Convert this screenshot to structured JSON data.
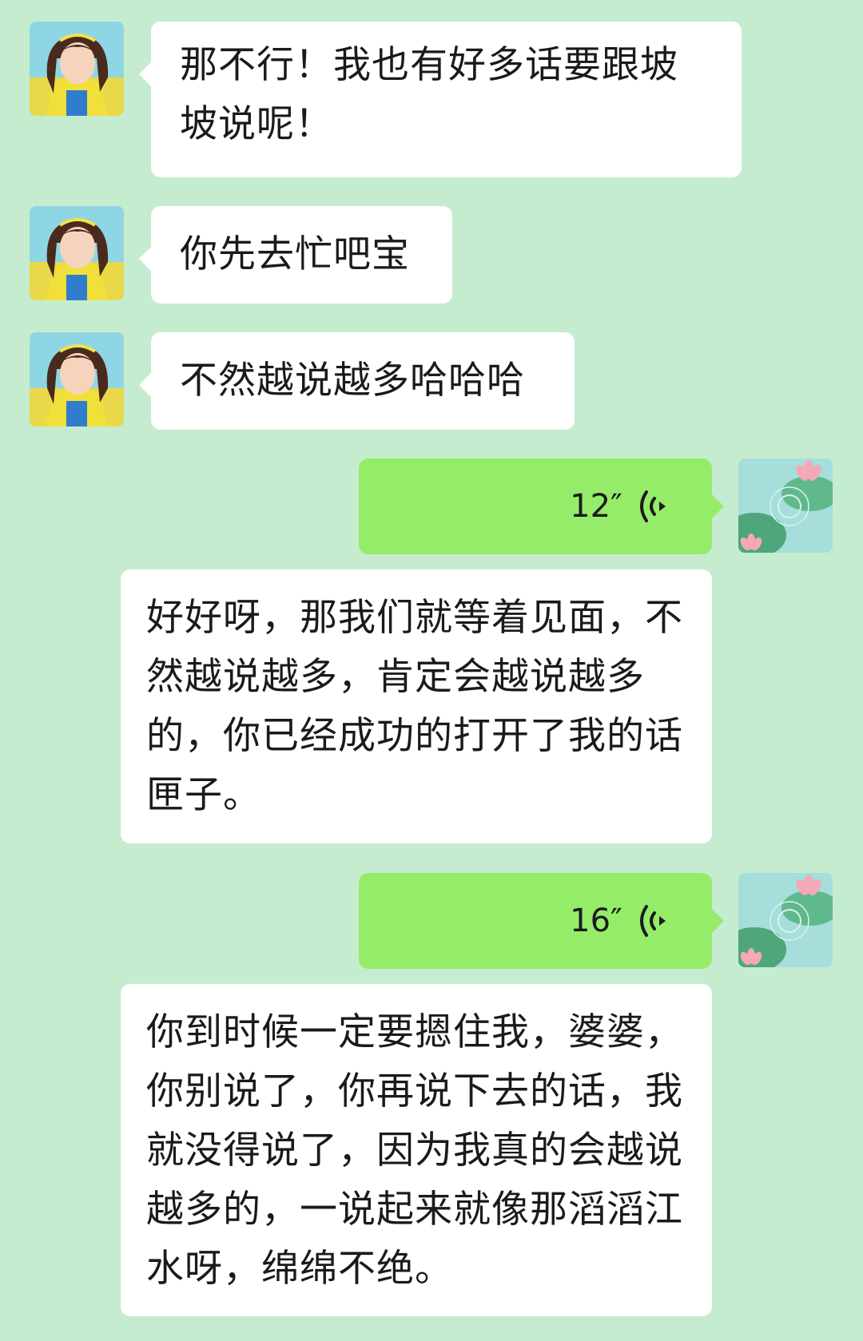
{
  "messages": [
    {
      "from": "other",
      "type": "text",
      "text": "那不行！我也有好多话要跟坡坡说呢！"
    },
    {
      "from": "other",
      "type": "text",
      "text": "你先去忙吧宝"
    },
    {
      "from": "other",
      "type": "text",
      "text": "不然越说越多哈哈哈"
    },
    {
      "from": "me",
      "type": "voice",
      "duration": "12″"
    },
    {
      "from": "other",
      "type": "text",
      "text": "好好呀，那我们就等着见面，不然越说越多，肯定会越说越多的，你已经成功的打开了我的话匣子。"
    },
    {
      "from": "me",
      "type": "voice",
      "duration": "16″"
    },
    {
      "from": "other",
      "type": "text",
      "text": "你到时候一定要摁住我，婆婆，你别说了，你再说下去的话，我就没得说了，因为我真的会越说越多的，一说起来就像那滔滔江水呀，绵绵不绝。"
    }
  ],
  "icons": {
    "other_avatar": "girl-portrait-avatar",
    "my_avatar": "lotus-pond-avatar",
    "voice": "voice-wave-icon"
  },
  "colors": {
    "background": "#c6ecd0",
    "incoming_bubble": "#ffffff",
    "outgoing_bubble": "#95ec69",
    "text": "#1a1a1a"
  }
}
